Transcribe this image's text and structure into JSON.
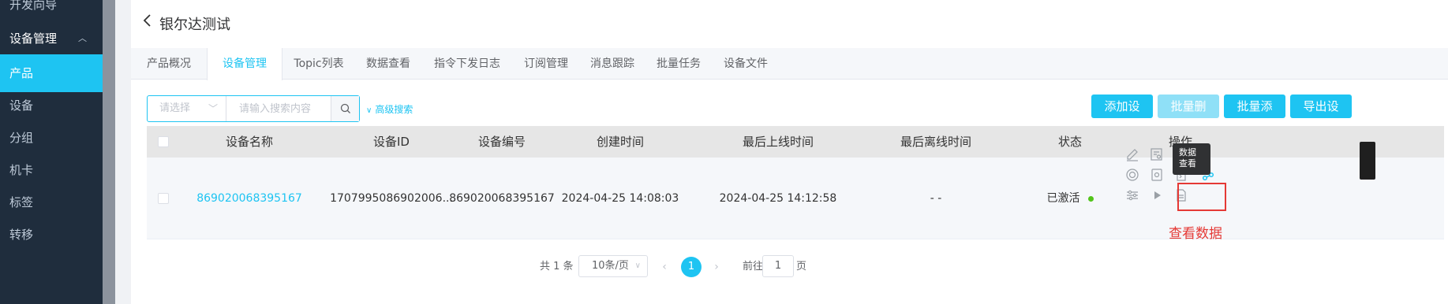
{
  "sidebar": {
    "items": [
      {
        "label": "开发向导"
      },
      {
        "label": "设备管理"
      },
      {
        "label": "产品"
      },
      {
        "label": "设备"
      },
      {
        "label": "分组"
      },
      {
        "label": "机卡"
      },
      {
        "label": "标签"
      },
      {
        "label": "转移"
      }
    ],
    "active_index": 2
  },
  "header": {
    "title": "银尔达测试"
  },
  "tabs": [
    {
      "label": "产品概况"
    },
    {
      "label": "设备管理"
    },
    {
      "label": "Topic列表"
    },
    {
      "label": "数据查看"
    },
    {
      "label": "指令下发日志"
    },
    {
      "label": "订阅管理"
    },
    {
      "label": "消息跟踪"
    },
    {
      "label": "批量任务"
    },
    {
      "label": "设备文件"
    }
  ],
  "active_tab": 1,
  "toolbar": {
    "select_placeholder": "请选择",
    "search_placeholder": "请输入搜索内容",
    "advanced_search": "高级搜索",
    "add_device": "添加设备",
    "batch_delete": "批量删除",
    "batch_add": "批量添加",
    "export_device": "导出设备"
  },
  "table": {
    "columns": [
      "设备名称",
      "设备ID",
      "设备编号",
      "创建时间",
      "最后上线时间",
      "最后离线时间",
      "状态",
      "操作"
    ],
    "rows": [
      {
        "name": "869020068395167",
        "device_id": "1707995086902006...",
        "device_no": "869020068395167",
        "created": "2024-04-25 14:08:03",
        "last_online": "2024-04-25 14:12:58",
        "last_offline": "- -",
        "status": "已激活"
      }
    ]
  },
  "tooltip": {
    "text": "数据查看"
  },
  "annotation": {
    "text": "查看数据"
  },
  "pagination": {
    "total": "共 1 条",
    "page_size": "10条/页",
    "current_page": "1",
    "goto_label": "前往",
    "goto_value": "1",
    "page_unit": "页"
  },
  "colors": {
    "accent": "#1ec4f2",
    "sidebar_bg": "#1f2d3d",
    "annotation": "#e53935",
    "status_ok": "#52c41a"
  }
}
